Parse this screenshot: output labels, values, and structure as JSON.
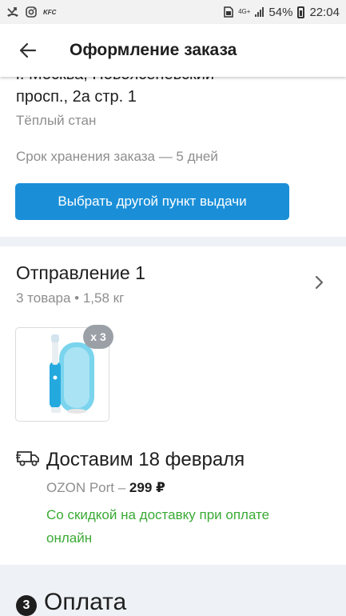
{
  "status_bar": {
    "kfc": "KFC",
    "network": "4G+",
    "battery": "54%",
    "time": "22:04",
    "icons": [
      "missed-call-icon",
      "instagram-icon",
      "kfc-icon",
      "sim-icon",
      "signal-icon",
      "battery-icon"
    ]
  },
  "header": {
    "title": "Оформление заказа",
    "back_icon": "arrow-left-icon"
  },
  "pickup": {
    "address_line1": "г. Москва, Новоясеневский",
    "address_line2": "просп., 2а стр. 1",
    "metro": "Тёплый стан",
    "storage": "Срок хранения заказа — 5 дней",
    "change_button": "Выбрать другой пункт выдачи"
  },
  "shipment": {
    "title": "Отправление 1",
    "meta": "3 товара • 1,58 кг",
    "product_qty": "x 3",
    "product_icon": "toothbrush-image",
    "delivery_date": "Доставим 18 февраля",
    "carrier": "OZON Port –",
    "carrier_price": "299 ₽",
    "discount_note": "Со скидкой на доставку при оплате онлайн"
  },
  "payment": {
    "step": "3",
    "title": "Оплата"
  },
  "colors": {
    "accent": "#1a8fd8",
    "green": "#3aaa35",
    "muted": "#8e8e8e",
    "section_bg": "#eef1f5"
  }
}
